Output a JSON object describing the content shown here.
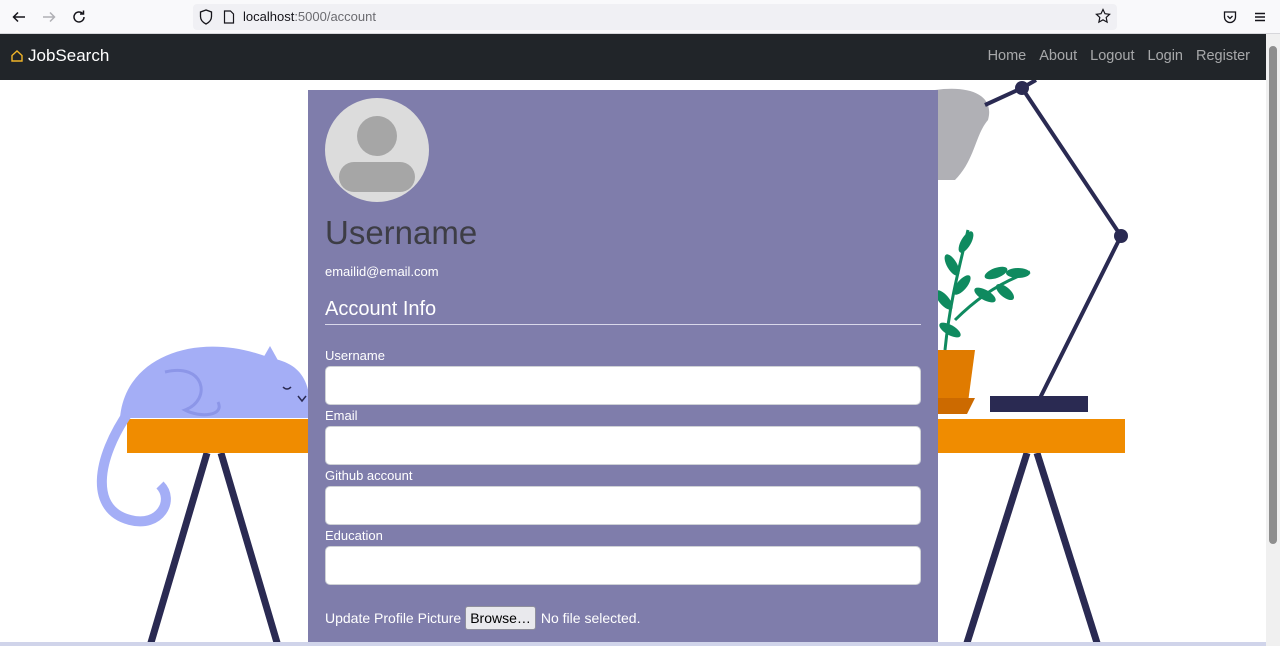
{
  "browser": {
    "url_host": "localhost",
    "url_path": ":5000/account"
  },
  "navbar": {
    "brand": "JobSearch",
    "links": [
      "Home",
      "About",
      "Logout",
      "Login",
      "Register"
    ]
  },
  "profile": {
    "username": "Username",
    "email": "emailid@email.com"
  },
  "form": {
    "section_title": "Account Info",
    "fields": [
      {
        "label": "Username",
        "value": ""
      },
      {
        "label": "Email",
        "value": ""
      },
      {
        "label": "Github account",
        "value": ""
      },
      {
        "label": "Education",
        "value": ""
      }
    ],
    "upload_label": "Update Profile Picture",
    "browse_label": "Browse…",
    "file_status": "No file selected."
  },
  "colors": {
    "navbar_bg": "#212529",
    "card_bg": "#7f7dab",
    "brand_icon": "#f0b429"
  }
}
